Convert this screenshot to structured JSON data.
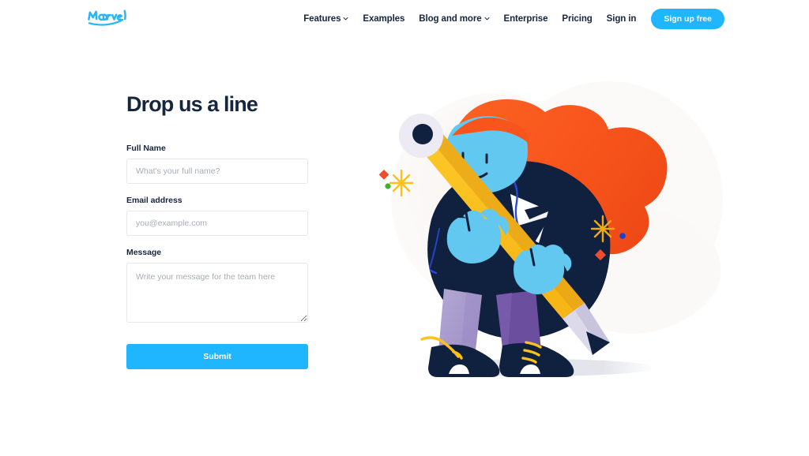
{
  "header": {
    "logo": {
      "name": "Marvel",
      "icon": "marvel-wordmark-logo",
      "color": "#29b6f6"
    },
    "nav_items": [
      {
        "label": "Features",
        "has_chevron": true
      },
      {
        "label": "Examples",
        "has_chevron": false
      },
      {
        "label": "Blog and more",
        "has_chevron": true
      },
      {
        "label": "Enterprise",
        "has_chevron": false
      },
      {
        "label": "Pricing",
        "has_chevron": false
      },
      {
        "label": "Sign in",
        "has_chevron": false
      }
    ],
    "signup_button": {
      "label": "Sign up free",
      "background": "#1fb6ff",
      "text_color": "#ffffff"
    }
  },
  "main": {
    "title": "Drop us a line",
    "fields": {
      "full_name": {
        "label": "Full Name",
        "placeholder": "What's your full name?",
        "value": ""
      },
      "email": {
        "label": "Email address",
        "placeholder": "you@example.com",
        "value": ""
      },
      "message": {
        "label": "Message",
        "placeholder": "Write your message for the team here",
        "value": ""
      }
    },
    "submit_button": {
      "label": "Submit",
      "background": "#1fb6ff",
      "text_color": "#ffffff"
    }
  },
  "illustration": {
    "name": "person-carrying-giant-pencil",
    "description": "Flat illustration of a blue-skinned character with flowing orange hair wearing a dark navy jacket and purple trousers, carrying a large yellow pencil diagonally across the body",
    "colors": {
      "hair": "#f8551c",
      "skin": "#63c8f0",
      "jacket": "#10203f",
      "pants_light": "#a396c8",
      "pants_dark": "#6b4e9e",
      "pencil_body": "#fcc11a",
      "pencil_shadow": "#e8a417",
      "pencil_wood": "#dcdaea",
      "pencil_graphite": "#10203f",
      "eraser": "#e2e0ee",
      "shoes": "#10203f",
      "laces": "#fcc11a",
      "background_blob": "#faf8f6",
      "ground_shadow": "#dfe2e8"
    },
    "decorations": [
      {
        "name": "red-diamond-left",
        "color": "#ee4d2e"
      },
      {
        "name": "green-dot-left",
        "color": "#43b02a"
      },
      {
        "name": "yellow-star-left",
        "color": "#fcc11a"
      },
      {
        "name": "yellow-star-right",
        "color": "#f2a90f"
      },
      {
        "name": "blue-dot-right",
        "color": "#1f3fd1"
      },
      {
        "name": "red-diamond-right",
        "color": "#ee4d2e"
      }
    ]
  }
}
